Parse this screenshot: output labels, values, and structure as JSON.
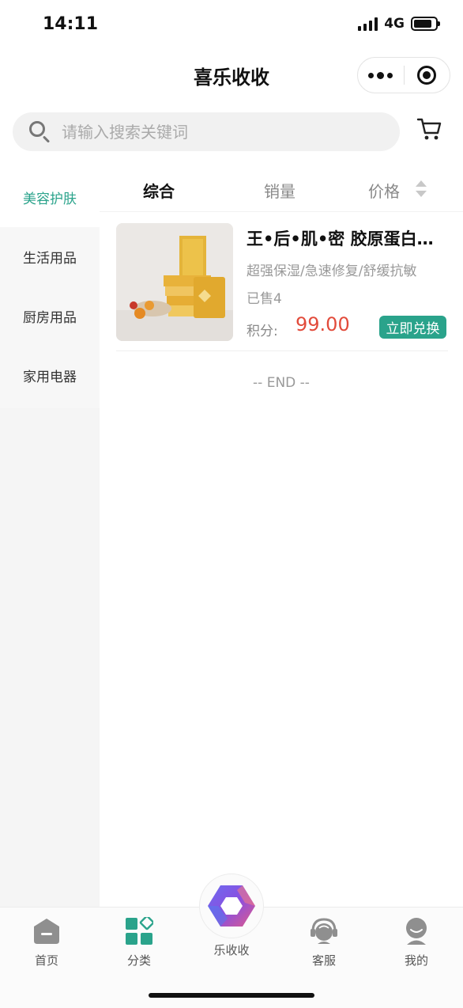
{
  "status_bar": {
    "time": "14:11",
    "network": "4G"
  },
  "header": {
    "title": "喜乐收收"
  },
  "search": {
    "placeholder": "请输入搜索关键词"
  },
  "sidebar": {
    "items": [
      {
        "label": "美容护肤",
        "active": true
      },
      {
        "label": "生活用品",
        "active": false
      },
      {
        "label": "厨房用品",
        "active": false
      },
      {
        "label": "家用电器",
        "active": false
      }
    ]
  },
  "sort_tabs": {
    "comprehensive": "综合",
    "sales": "销量",
    "price": "价格"
  },
  "products": [
    {
      "title": "王•后•肌•密 胶原蛋白精华面膜",
      "subtitle": "超强保湿/急速修复/舒缓抗敏",
      "sold": "已售4",
      "price_label": "积分:",
      "price": "99.00",
      "button": "立即兑换"
    }
  ],
  "list_end": "-- END --",
  "tab_bar": {
    "home": "首页",
    "category": "分类",
    "center": "乐收收",
    "service": "客服",
    "mine": "我的"
  },
  "colors": {
    "accent": "#2aa38b",
    "price": "#e24b3b"
  }
}
